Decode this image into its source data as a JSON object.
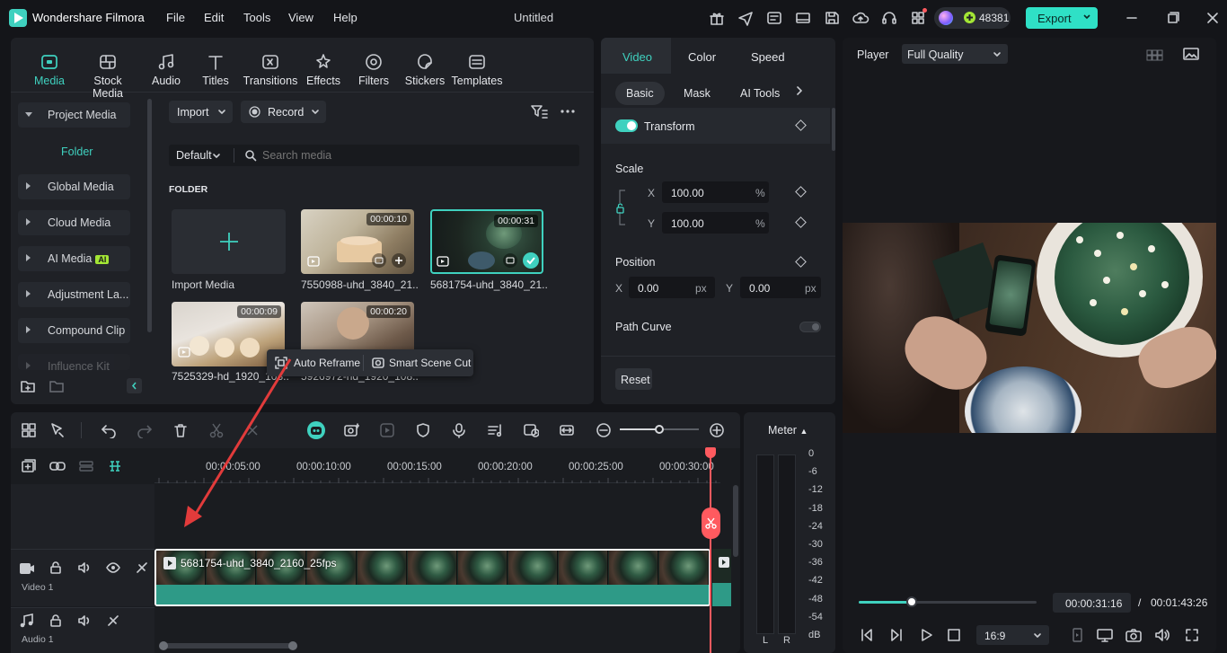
{
  "app": {
    "name": "Wondershare Filmora",
    "document_title": "Untitled",
    "credits": "48381",
    "export_label": "Export"
  },
  "menu": [
    "File",
    "Edit",
    "Tools",
    "View",
    "Help"
  ],
  "toolbar": [
    {
      "label": "Media",
      "icon": "media-icon"
    },
    {
      "label": "Stock Media",
      "icon": "stock-media-icon"
    },
    {
      "label": "Audio",
      "icon": "audio-icon"
    },
    {
      "label": "Titles",
      "icon": "titles-icon"
    },
    {
      "label": "Transitions",
      "icon": "transitions-icon"
    },
    {
      "label": "Effects",
      "icon": "effects-icon"
    },
    {
      "label": "Filters",
      "icon": "filters-icon"
    },
    {
      "label": "Stickers",
      "icon": "stickers-icon"
    },
    {
      "label": "Templates",
      "icon": "templates-icon"
    }
  ],
  "sidebar": {
    "project_media": "Project Media",
    "folder": "Folder",
    "items": [
      "Global Media",
      "Cloud Media",
      "AI Media",
      "Adjustment La...",
      "Compound Clip",
      "Influence Kit"
    ],
    "ai_badge": "AI"
  },
  "media": {
    "import_label": "Import",
    "record_label": "Record",
    "sort_label": "Default",
    "search_placeholder": "Search media",
    "folder_heading": "FOLDER",
    "import_media_label": "Import Media",
    "clips": [
      {
        "name": "7550988-uhd_3840_21...",
        "duration": "00:00:10"
      },
      {
        "name": "5681754-uhd_3840_21...",
        "duration": "00:00:31"
      },
      {
        "name": "7525329-hd_1920_108...",
        "duration": "00:00:09"
      },
      {
        "name": "5926972-hd_1920_108...",
        "duration": "00:00:20"
      }
    ],
    "popup": {
      "auto_reframe": "Auto Reframe",
      "smart_scene_cut": "Smart Scene Cut"
    }
  },
  "properties": {
    "tabs": [
      "Video",
      "Color",
      "Speed"
    ],
    "subtabs": [
      "Basic",
      "Mask",
      "AI Tools"
    ],
    "transform_label": "Transform",
    "scale_label": "Scale",
    "scale_x": "100.00",
    "scale_y": "100.00",
    "percent": "%",
    "position_label": "Position",
    "pos_x": "0.00",
    "pos_y": "0.00",
    "px": "px",
    "x": "X",
    "y": "Y",
    "path_curve_label": "Path Curve",
    "reset_label": "Reset"
  },
  "player": {
    "label": "Player",
    "quality": "Full Quality",
    "current_time": "00:00:31:16",
    "separator": "/",
    "total_time": "00:01:43:26",
    "aspect": "16:9",
    "progress": 0.3
  },
  "timeline": {
    "ruler": [
      "00:00:05:00",
      "00:00:10:00",
      "00:00:15:00",
      "00:00:20:00",
      "00:00:25:00",
      "00:00:30:00"
    ],
    "clip_name": "5681754-uhd_3840_2160_25fps",
    "video_track": "Video 1",
    "audio_track": "Audio 1",
    "meter_label": "Meter",
    "meter_scale": [
      "0",
      "-6",
      "-12",
      "-18",
      "-24",
      "-30",
      "-36",
      "-42",
      "-48",
      "-54",
      "dB"
    ],
    "meter_lr": [
      "L",
      "R"
    ]
  },
  "colors": {
    "accent": "#3fd1bf",
    "export_bg": "#2fe0c6",
    "playhead": "#ff5a5f",
    "clip_teal": "#2e9a87"
  }
}
